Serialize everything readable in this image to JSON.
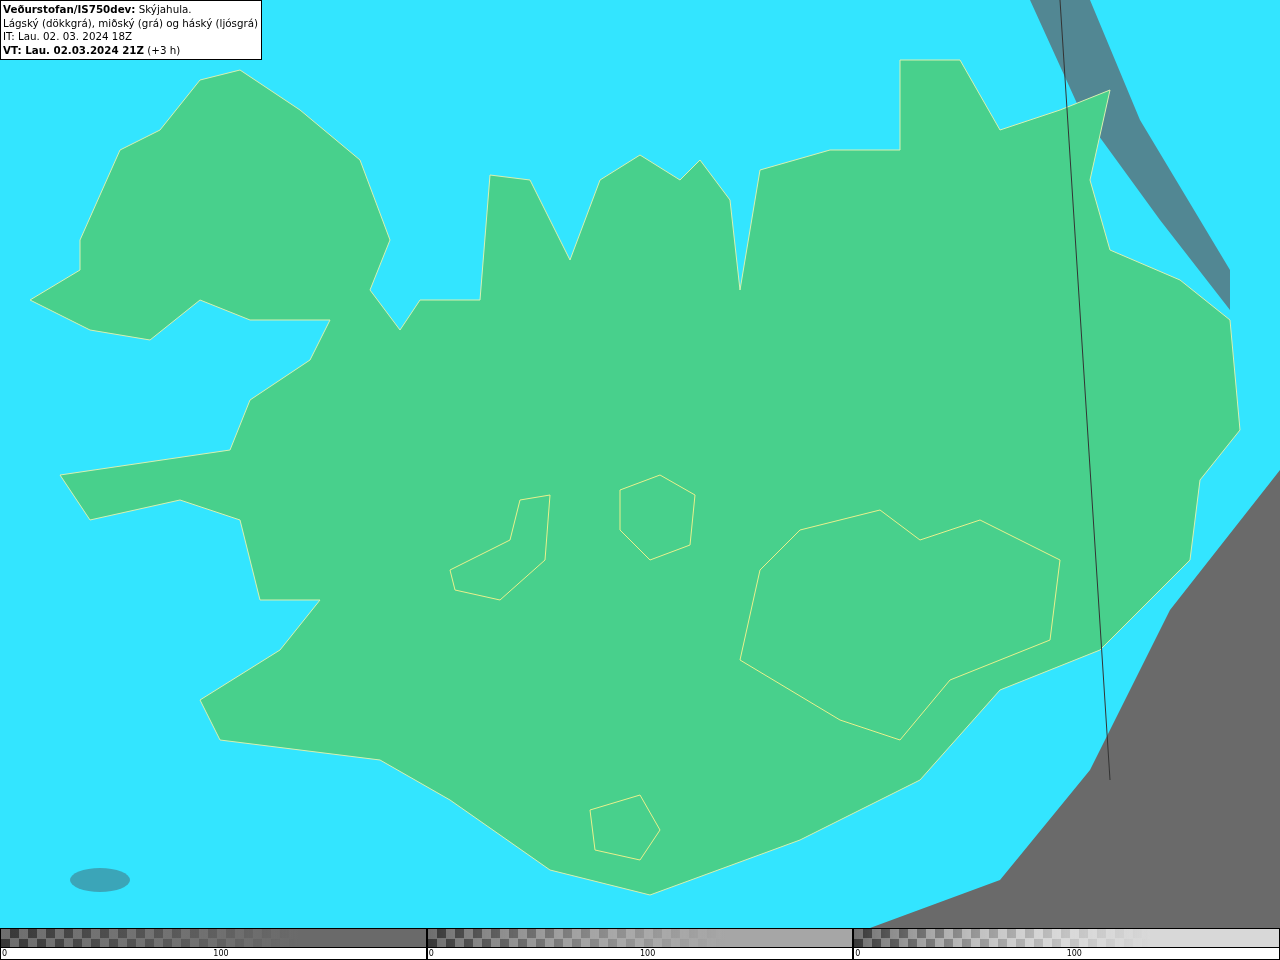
{
  "info_box": {
    "lines": [
      "**Veðurstofan/IS750dev:** Skýjahula.",
      "Lágský (dökkgrá), miðský (grá) og háský (ljósgrá)",
      "IT: Lau. 02. 03. 2024 18Z",
      "**VT: Lau. 02.03.2024 21Z** (+3 h)"
    ]
  },
  "legends": [
    {
      "kind": "low",
      "ticks": [
        "0",
        "100"
      ]
    },
    {
      "kind": "mid",
      "ticks": [
        "0",
        "100"
      ]
    },
    {
      "kind": "high",
      "ticks": [
        "0",
        "100"
      ]
    }
  ]
}
